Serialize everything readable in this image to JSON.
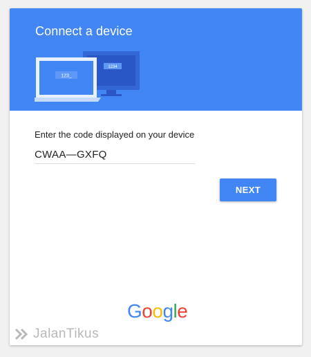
{
  "header": {
    "title": "Connect a device",
    "accent_color": "#4285f4",
    "illustration": {
      "laptop_screen_text": "123_",
      "monitor_screen_text": "1234"
    }
  },
  "form": {
    "label": "Enter the code displayed on your device",
    "code_value": "CWAA—GXFQ",
    "next_label": "NEXT"
  },
  "footer": {
    "logo_letters": [
      "G",
      "o",
      "o",
      "g",
      "l",
      "e"
    ],
    "logo_colors": [
      "#4285f4",
      "#ea4335",
      "#fbbc05",
      "#4285f4",
      "#34a853",
      "#ea4335"
    ]
  },
  "watermark": {
    "text": "JalanTikus",
    "icon": "chevron-right-double-icon"
  }
}
